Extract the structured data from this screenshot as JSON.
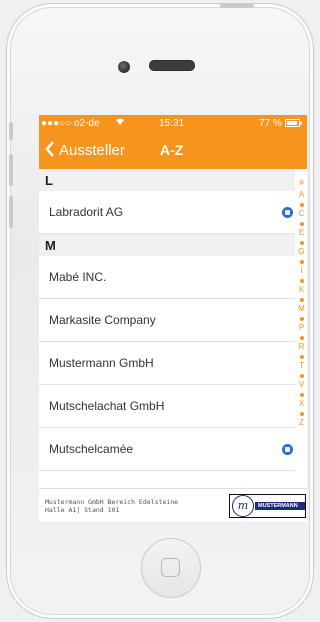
{
  "status_bar": {
    "carrier": "●●●○○ o2-de",
    "wifi_icon": "wifi-icon",
    "time": "15:31",
    "battery": "77 %"
  },
  "navbar": {
    "back_label": "Aussteller",
    "title": "A-Z",
    "accent_color": "#f7941d"
  },
  "list": {
    "sections": [
      {
        "letter": "L",
        "rows": [
          {
            "label": "Labradorit AG",
            "has_icon": true
          }
        ]
      },
      {
        "letter": "M",
        "rows": [
          {
            "label": "Mabé INC.",
            "has_icon": false
          },
          {
            "label": "Markasite Company",
            "has_icon": false
          },
          {
            "label": "Mustermann GmbH",
            "has_icon": false
          },
          {
            "label": "Mutschelachat GmbH",
            "has_icon": false
          },
          {
            "label": "Mutschelcamée",
            "has_icon": true
          }
        ]
      }
    ]
  },
  "index": [
    "#",
    "A",
    "C",
    "E",
    "G",
    "I",
    "K",
    "M",
    "P",
    "R",
    "T",
    "V",
    "X",
    "Z"
  ],
  "footer": {
    "line1": "Mustermann GmbH Bereich Edelsteine",
    "line2": "Halle A1| Stand 101",
    "logo_text": "MUSTERMANN",
    "logo_mark": "m"
  }
}
